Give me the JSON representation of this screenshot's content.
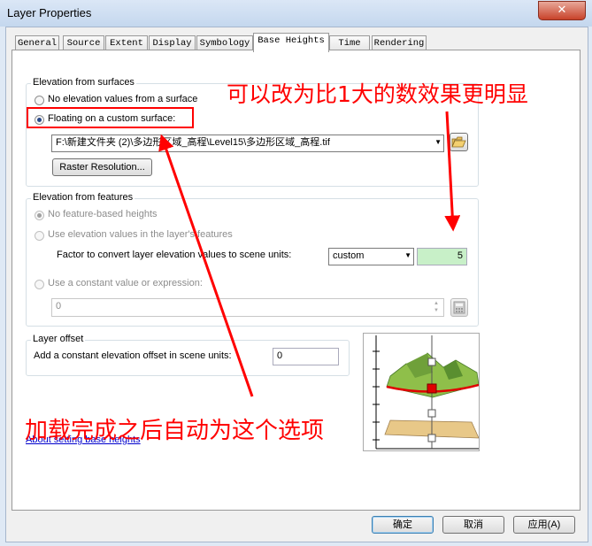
{
  "window": {
    "title": "Layer Properties",
    "close_glyph": "✕"
  },
  "tabs": [
    {
      "label": "General"
    },
    {
      "label": "Source"
    },
    {
      "label": "Extent"
    },
    {
      "label": "Display"
    },
    {
      "label": "Symbology"
    },
    {
      "label": "Base Heights"
    },
    {
      "label": "Time"
    },
    {
      "label": "Rendering"
    }
  ],
  "elevation_surfaces": {
    "group_label": "Elevation from surfaces",
    "option_none": "No elevation values from a surface",
    "option_floating": "Floating on a custom surface:",
    "surface_path": "F:\\新建文件夹 (2)\\多边形区域_高程\\Level15\\多边形区域_高程.tif",
    "raster_button": "Raster Resolution..."
  },
  "elevation_features": {
    "group_label": "Elevation from features",
    "option_no_feature": "No feature-based heights",
    "option_use_values": "Use elevation values in the layer's features",
    "factor_label": "Factor to convert layer elevation values to scene units:",
    "factor_unit": "custom",
    "factor_value": "5",
    "option_constant": "Use a constant value or expression:",
    "expression_value": "0"
  },
  "layer_offset": {
    "group_label": "Layer offset",
    "offset_label": "Add a constant elevation offset in scene units:",
    "offset_value": "0"
  },
  "help_link": "About setting base heights",
  "footer": {
    "ok": "确定",
    "cancel": "取消",
    "apply": "应用(A)"
  },
  "annotations": {
    "top_note": "可以改为比1大的数效果更明显",
    "bottom_note": "加载完成之后自动为这个选项"
  },
  "colors": {
    "annotation_red": "#ff0000",
    "highlight_green": "#c8f0c8"
  }
}
